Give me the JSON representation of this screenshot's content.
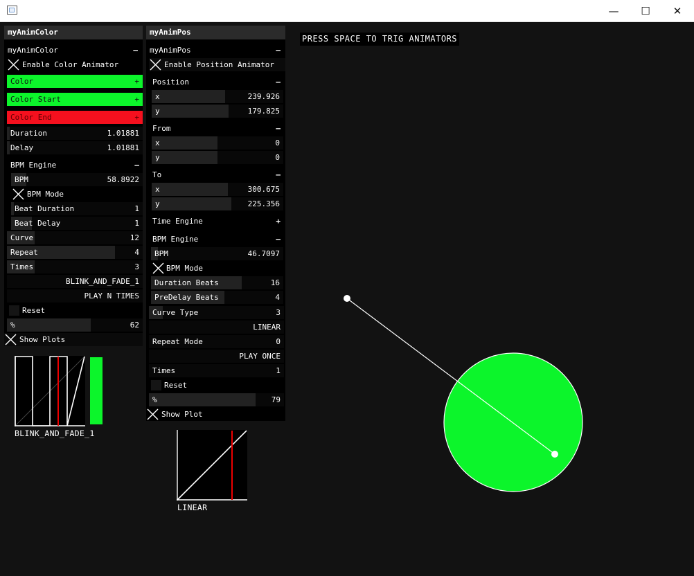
{
  "window": {
    "minimize": "—",
    "maximize": "☐",
    "close": "✕"
  },
  "hint": "PRESS SPACE TO TRIG ANIMATORS",
  "color_panel": {
    "title": "myAnimColor",
    "group": "myAnimColor",
    "group_toggle": "–",
    "enable": "Enable Color Animator",
    "color": {
      "label": "Color",
      "icon": "+",
      "hex": "#0cf52b"
    },
    "color_start": {
      "label": "Color Start",
      "icon": "+",
      "hex": "#0cf52b"
    },
    "color_end": {
      "label": "Color End",
      "icon": "+",
      "hex": "#f5101e"
    },
    "duration": {
      "label": "Duration",
      "value": "1.01881"
    },
    "delay": {
      "label": "Delay",
      "value": "1.01881"
    },
    "bpm_engine": {
      "label": "BPM Engine",
      "toggle": "–"
    },
    "bpm": {
      "label": "BPM",
      "value": "58.8922"
    },
    "bpm_mode": "BPM Mode",
    "beat_duration": {
      "label": "Beat Duration",
      "value": "1"
    },
    "beat_delay": {
      "label": "Beat Delay",
      "value": "1"
    },
    "curve": {
      "label": "Curve",
      "value": "12"
    },
    "repeat": {
      "label": "Repeat",
      "value": "4"
    },
    "times": {
      "label": "Times",
      "value": "3"
    },
    "curve_name": "BLINK_AND_FADE_1",
    "play_mode": "PLAY N TIMES",
    "reset": "Reset",
    "percent": {
      "label": "%",
      "value": "62"
    },
    "show_plots": "Show Plots",
    "plot_caption": "BLINK_AND_FADE_1"
  },
  "pos_panel": {
    "title": "myAnimPos",
    "group": "myAnimPos",
    "group_toggle": "–",
    "enable": "Enable Position Animator",
    "position": {
      "label": "Position",
      "toggle": "–",
      "x_label": "x",
      "x": "239.926",
      "y_label": "y",
      "y": "179.825"
    },
    "from": {
      "label": "From",
      "toggle": "–",
      "x_label": "x",
      "x": "0",
      "y_label": "y",
      "y": "0"
    },
    "to": {
      "label": "To",
      "toggle": "–",
      "x_label": "x",
      "x": "300.675",
      "y_label": "y",
      "y": "225.356"
    },
    "time_engine": {
      "label": "Time Engine",
      "toggle": "+"
    },
    "bpm_engine": {
      "label": "BPM Engine",
      "toggle": "–"
    },
    "bpm": {
      "label": "BPM",
      "value": "46.7097"
    },
    "bpm_mode": "BPM Mode",
    "duration_beats": {
      "label": "Duration Beats",
      "value": "16"
    },
    "predelay_beats": {
      "label": "PreDelay Beats",
      "value": "4"
    },
    "curve_type": {
      "label": "Curve Type",
      "value": "3"
    },
    "curve_name": "LINEAR",
    "repeat_mode": {
      "label": "Repeat Mode",
      "value": "0"
    },
    "play_mode": "PLAY ONCE",
    "times": {
      "label": "Times",
      "value": "1"
    },
    "reset": "Reset",
    "percent": {
      "label": "%",
      "value": "79"
    },
    "show_plot": "Show Plot",
    "plot_caption": "LINEAR"
  },
  "colors": {
    "accent_green": "#0cf52b",
    "accent_red": "#f5101e",
    "bg": "#121212"
  }
}
